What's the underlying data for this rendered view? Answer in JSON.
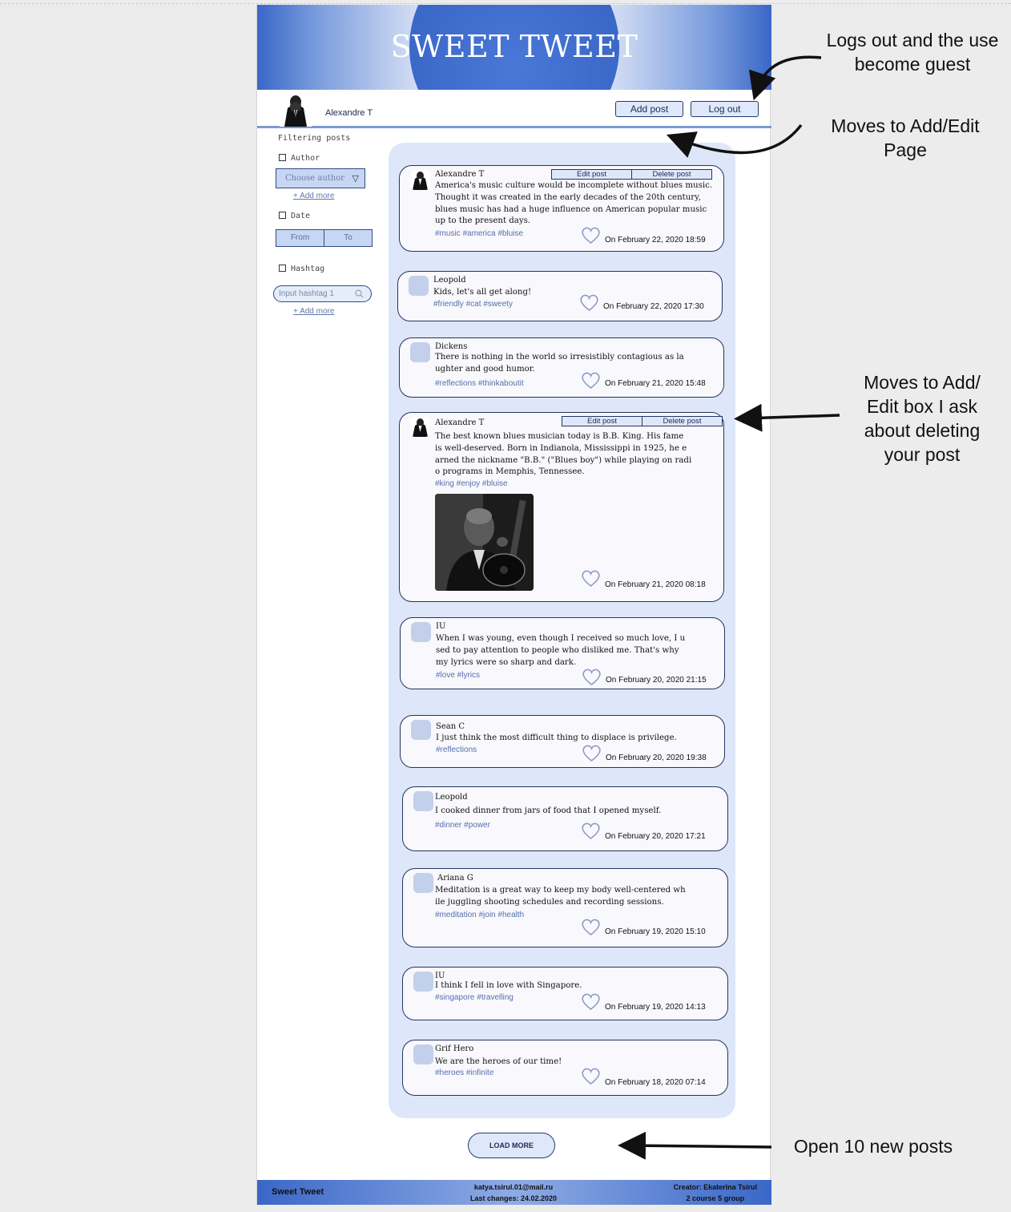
{
  "app": {
    "logo": "SWEET TWEET"
  },
  "user": {
    "name": "Alexandre T",
    "add_post": "Add post",
    "log_out": "Log out"
  },
  "filters": {
    "title": "Filtering posts",
    "author_label": "Author",
    "author_placeholder": "Choose author",
    "add_more": "+ Add more",
    "date_label": "Date",
    "date_from": "From",
    "date_to": "To",
    "hashtag_label": "Hashtag",
    "hashtag_placeholder": "Input hashtag 1"
  },
  "post_actions": {
    "edit": "Edit post",
    "delete": "Delete post"
  },
  "posts": [
    {
      "author": "Alexandre T",
      "lines": [
        "America's music culture would be incomplete without blues music.",
        "Thought it was created in the early decades of the 20th century,",
        "blues music has had a huge influence on American popular music",
        "up to the present days."
      ],
      "tags": "#music #america #bluise",
      "date": "On February 22, 2020 18:59"
    },
    {
      "author": "Leopold",
      "lines": [
        "Kids, let's all get along!"
      ],
      "tags": "#friendly #cat #sweety",
      "date": "On February 22, 2020 17:30"
    },
    {
      "author": "Dickens",
      "lines": [
        "There is nothing in the world so irresistibly contagious as la",
        "ughter and good humor."
      ],
      "tags": "#reflections #thinkaboutit",
      "date": "On February 21, 2020 15:48"
    },
    {
      "author": "Alexandre T",
      "lines": [
        "The best known blues musician today is B.B. King. His fame",
        "is well-deserved. Born in Indianola, Mississippi in 1925, he e",
        "arned the nickname \"B.B.\" (\"Blues boy\") while playing on radi",
        "o programs in Memphis, Tennessee."
      ],
      "tags": "#king #enjoy #bluise",
      "date": "On February 21, 2020 08:18"
    },
    {
      "author": "IU",
      "lines": [
        "When I was young, even though I received so much love, I u",
        "sed to pay attention to people who disliked me. That's why",
        "my lyrics were so sharp and dark."
      ],
      "tags": "#love #lyrics",
      "date": "On February 20, 2020 21:15"
    },
    {
      "author": "Sean C",
      "lines": [
        "I just think the most difficult thing to displace is privilege."
      ],
      "tags": "#reflections",
      "date": "On February 20, 2020 19:38"
    },
    {
      "author": "Leopold",
      "lines": [
        "I cooked dinner from jars of food that I opened myself."
      ],
      "tags": "#dinner #power",
      "date": "On February 20, 2020 17:21"
    },
    {
      "author": "Ariana G",
      "lines": [
        "Meditation is a great way to keep my body well-centered wh",
        "ile juggling shooting schedules and recording sessions."
      ],
      "tags": "#meditation #join #health",
      "date": "On February 19, 2020 15:10"
    },
    {
      "author": "IU",
      "lines": [
        "I think I fell in love with Singapore."
      ],
      "tags": "#singapore #travelling",
      "date": "On February 19, 2020 14:13"
    },
    {
      "author": "Grif Hero",
      "lines": [
        "We are the heroes of our time!"
      ],
      "tags": "#heroes #infinite",
      "date": "On February 18, 2020 07:14"
    }
  ],
  "load_more": "LOAD MORE",
  "footer": {
    "brand": "Sweet Tweet",
    "email": "katya.tsirul.01@mail.ru",
    "last_changes": "Last changes: 24.02.2020",
    "creator": "Creator: Ekaterina Tsirul",
    "group": "2 course 5 group"
  },
  "annotations": {
    "logout": "Logs out and the use\nbecome guest",
    "add_edit": "Moves to Add/Edit\nPage",
    "edit_box": "Moves to Add/\nEdit box I ask\nabout deleting\nyour post",
    "load_more": "Open 10 new posts"
  },
  "colors": {
    "accent": "#3a67c7",
    "feed_bg": "#dee7f9",
    "button_bg": "#dfe8fa",
    "tag": "#5570b0"
  }
}
